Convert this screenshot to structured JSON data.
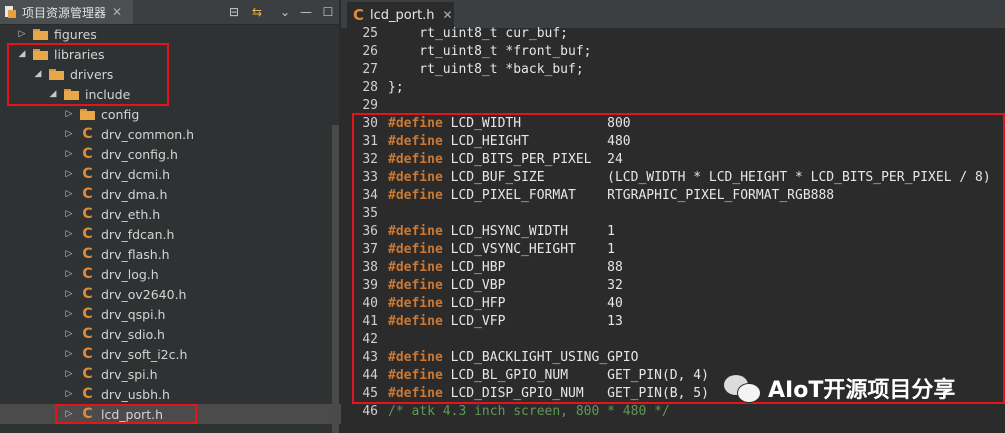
{
  "explorer": {
    "title": "项目资源管理器",
    "close": "✕",
    "toolbar": {
      "collapse": "⊟",
      "link": "⇆",
      "menu": "⌄",
      "minimize": "—",
      "maximize": "☐"
    },
    "items": [
      {
        "label": "figures"
      },
      {
        "label": "libraries"
      },
      {
        "label": "drivers"
      },
      {
        "label": "include"
      },
      {
        "label": "config"
      },
      {
        "label": "drv_common.h"
      },
      {
        "label": "drv_config.h"
      },
      {
        "label": "drv_dcmi.h"
      },
      {
        "label": "drv_dma.h"
      },
      {
        "label": "drv_eth.h"
      },
      {
        "label": "drv_fdcan.h"
      },
      {
        "label": "drv_flash.h"
      },
      {
        "label": "drv_log.h"
      },
      {
        "label": "drv_ov2640.h"
      },
      {
        "label": "drv_qspi.h"
      },
      {
        "label": "drv_sdio.h"
      },
      {
        "label": "drv_soft_i2c.h"
      },
      {
        "label": "drv_spi.h"
      },
      {
        "label": "drv_usbh.h"
      },
      {
        "label": "lcd_port.h"
      }
    ]
  },
  "editor": {
    "tab_label": "lcd_port.h",
    "close": "✕",
    "lines": [
      {
        "num": "25",
        "pre": "    rt_uint8_t cur_buf;"
      },
      {
        "num": "26",
        "pre": "    rt_uint8_t *front_buf;"
      },
      {
        "num": "27",
        "pre": "    rt_uint8_t *back_buf;"
      },
      {
        "num": "28",
        "pre": "};"
      },
      {
        "num": "29",
        "pre": ""
      },
      {
        "num": "30",
        "kw": "#define",
        "rest": " LCD_WIDTH           800"
      },
      {
        "num": "31",
        "kw": "#define",
        "rest": " LCD_HEIGHT          480"
      },
      {
        "num": "32",
        "kw": "#define",
        "rest": " LCD_BITS_PER_PIXEL  24"
      },
      {
        "num": "33",
        "kw": "#define",
        "rest": " LCD_BUF_SIZE        (LCD_WIDTH * LCD_HEIGHT * LCD_BITS_PER_PIXEL / 8)"
      },
      {
        "num": "34",
        "kw": "#define",
        "rest": " LCD_PIXEL_FORMAT    RTGRAPHIC_PIXEL_FORMAT_RGB888"
      },
      {
        "num": "35",
        "pre": ""
      },
      {
        "num": "36",
        "kw": "#define",
        "rest": " LCD_HSYNC_WIDTH     1"
      },
      {
        "num": "37",
        "kw": "#define",
        "rest": " LCD_VSYNC_HEIGHT    1"
      },
      {
        "num": "38",
        "kw": "#define",
        "rest": " LCD_HBP             88"
      },
      {
        "num": "39",
        "kw": "#define",
        "rest": " LCD_VBP             32"
      },
      {
        "num": "40",
        "kw": "#define",
        "rest": " LCD_HFP             40"
      },
      {
        "num": "41",
        "kw": "#define",
        "rest": " LCD_VFP             13"
      },
      {
        "num": "42",
        "pre": ""
      },
      {
        "num": "43",
        "kw": "#define",
        "rest": " LCD_BACKLIGHT_USING_GPIO"
      },
      {
        "num": "44",
        "kw": "#define",
        "rest": " LCD_BL_GPIO_NUM     GET_PIN(D, 4)"
      },
      {
        "num": "45",
        "kw": "#define",
        "rest": " LCD_DISP_GPIO_NUM   GET_PIN(B, 5)"
      },
      {
        "num": "46",
        "comment": "/* atk 4.3 inch screen, 800 * 480 */"
      }
    ]
  },
  "watermark": {
    "text": "AIoT开源项目分享"
  },
  "colors": {
    "highlight_border": "#e3151a",
    "keyword": "#cc7832",
    "comment": "#629755",
    "background": "#2b2b2b"
  }
}
